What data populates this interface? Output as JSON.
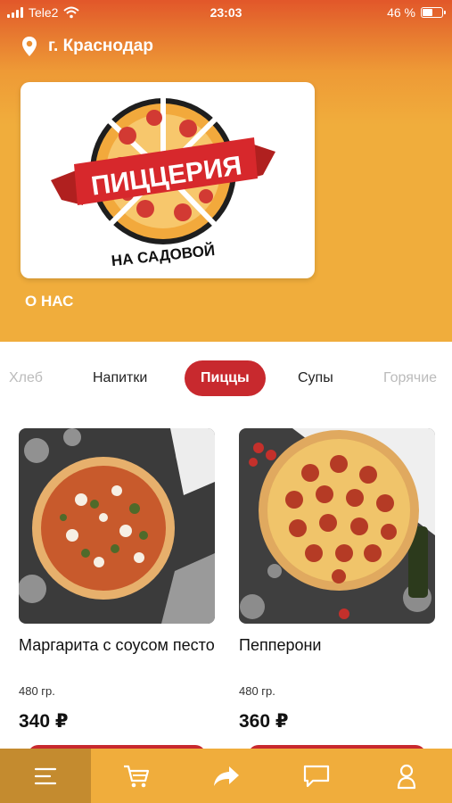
{
  "status": {
    "carrier": "Tele2",
    "time": "23:03",
    "battery": "46 %"
  },
  "location": {
    "city": "г. Краснодар"
  },
  "logo": {
    "line1": "ПИЦЦЕРИЯ",
    "line2": "НА САДОВОЙ"
  },
  "about_label": "О НАС",
  "categories": [
    "Хлеб",
    "Напитки",
    "Пиццы",
    "Супы",
    "Горячие"
  ],
  "active_category": "Пиццы",
  "products": [
    {
      "name": "Маргарита с соусом песто",
      "weight": "480 гр.",
      "price": "340 ₽"
    },
    {
      "name": "Пепперони",
      "weight": "480 гр.",
      "price": "360 ₽"
    }
  ],
  "bottom_nav": [
    "menu-icon",
    "cart-icon",
    "share-icon",
    "chat-icon",
    "profile-icon"
  ],
  "colors": {
    "accent": "#c8292e",
    "header": "#f0ad3c",
    "nav_active": "#c48b2f"
  }
}
